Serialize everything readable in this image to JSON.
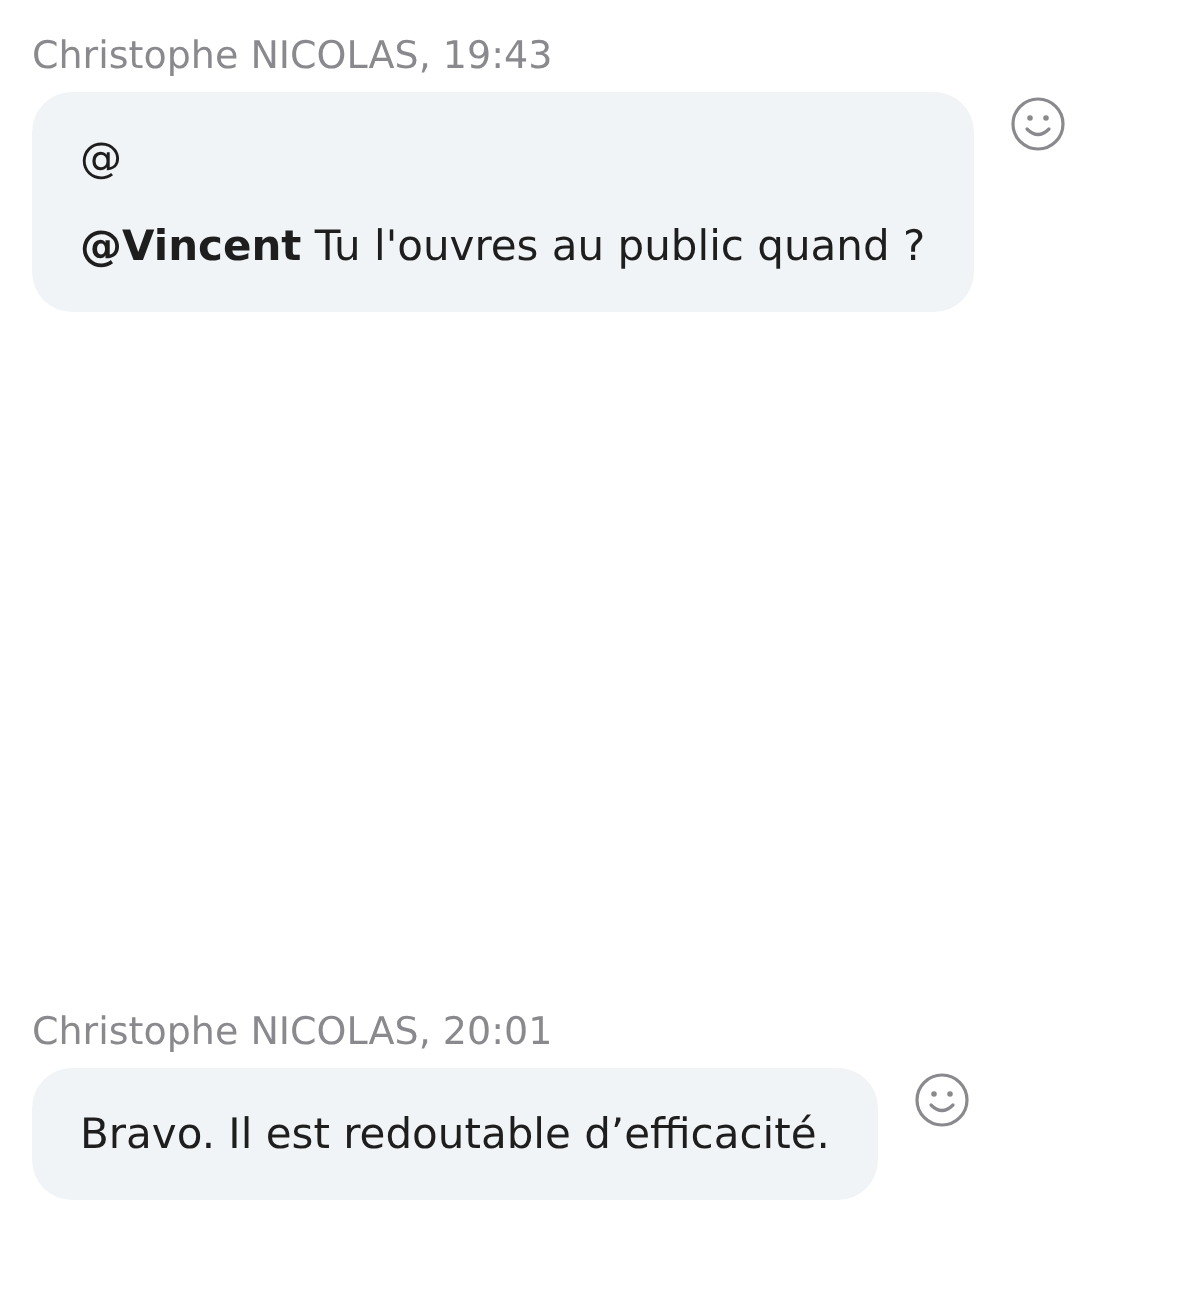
{
  "messages": [
    {
      "header": "Christophe NICOLAS, 19:43",
      "lines": [
        "@",
        "**@Vincent** Tu l'ouvres au public quand ?"
      ]
    },
    {
      "header": "Christophe NICOLAS, 20:01",
      "lines": [
        "Bravo. Il est redoutable d’efficacité."
      ]
    }
  ]
}
